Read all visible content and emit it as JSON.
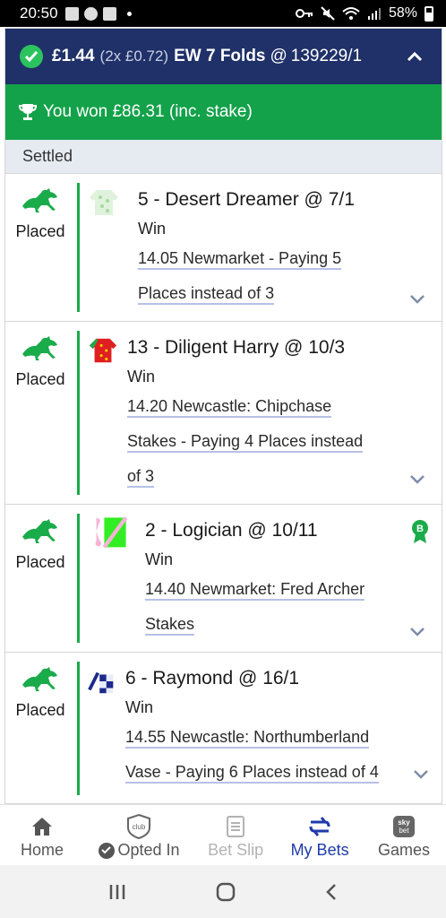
{
  "status_bar": {
    "time": "20:50",
    "battery": "58%"
  },
  "bet": {
    "stake": "£1.44",
    "stake_detail": "(2x £0.72)",
    "bet_type": "EW 7 Folds",
    "at": "@",
    "odds": "139229/1",
    "won_message": "You won £86.31 (inc. stake)",
    "section_label": "Settled",
    "accent_color": "#1f3168",
    "win_color": "#13a24a",
    "legs": [
      {
        "status": "Placed",
        "selection": "5 - Desert Dreamer @ 7/1",
        "market": "Win",
        "event_lines": [
          "14.05 Newmarket - Paying 5",
          "Places instead of 3"
        ],
        "silk": "green-white-silk-icon",
        "boost": false
      },
      {
        "status": "Placed",
        "selection": "13 - Diligent Harry @ 10/3",
        "market": "Win",
        "event_lines": [
          "14.20 Newcastle: Chipchase",
          "Stakes - Paying 4 Places instead",
          "of 3"
        ],
        "silk": "red-green-silk-icon",
        "boost": false
      },
      {
        "status": "Placed",
        "selection": "2 - Logician @ 10/11",
        "market": "Win",
        "event_lines": [
          "14.40 Newmarket: Fred Archer",
          "Stakes"
        ],
        "silk": "green-pink-silk-icon",
        "boost": true
      },
      {
        "status": "Placed",
        "selection": "6 - Raymond @ 16/1",
        "market": "Win",
        "event_lines": [
          "14.55 Newcastle: Northumberland",
          "Vase - Paying 6 Places instead of 4"
        ],
        "silk": "blue-white-silk-icon",
        "boost": false
      }
    ]
  },
  "bottom_nav": {
    "home": "Home",
    "club_icon_text": "club",
    "opted_in": "Opted In",
    "bet_slip": "Bet Slip",
    "my_bets": "My Bets",
    "games_icon_text_1": "sky",
    "games_icon_text_2": "bet",
    "games": "Games"
  }
}
